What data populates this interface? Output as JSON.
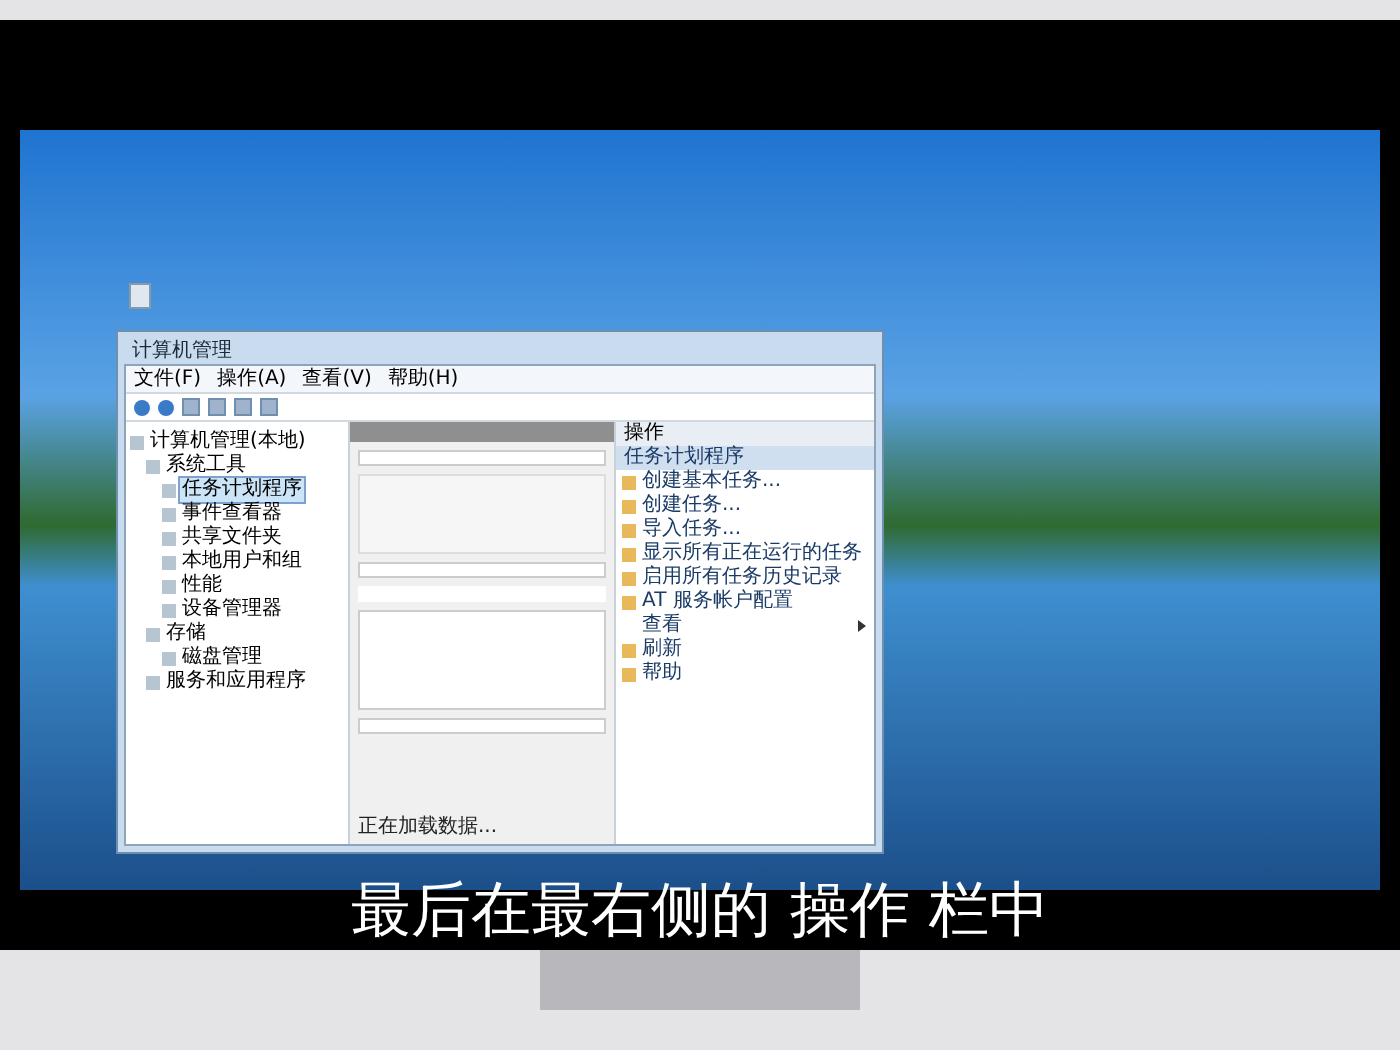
{
  "subtitle": "最后在最右侧的 操作 栏中",
  "window": {
    "title": "计算机管理",
    "menu": [
      "文件(F)",
      "操作(A)",
      "查看(V)",
      "帮助(H)"
    ],
    "tree": [
      {
        "label": "计算机管理(本地)",
        "selected": false,
        "children": [
          {
            "label": "系统工具",
            "selected": false,
            "children": [
              {
                "label": "任务计划程序",
                "selected": true
              },
              {
                "label": "事件查看器",
                "selected": false
              },
              {
                "label": "共享文件夹",
                "selected": false
              },
              {
                "label": "本地用户和组",
                "selected": false
              },
              {
                "label": "性能",
                "selected": false
              },
              {
                "label": "设备管理器",
                "selected": false
              }
            ]
          },
          {
            "label": "存储",
            "selected": false,
            "children": [
              {
                "label": "磁盘管理",
                "selected": false
              }
            ]
          },
          {
            "label": "服务和应用程序",
            "selected": false
          }
        ]
      }
    ],
    "status": "正在加载数据...",
    "actions": {
      "header": "操作",
      "section": "任务计划程序",
      "items": [
        {
          "kind": "item",
          "label": "创建基本任务..."
        },
        {
          "kind": "item",
          "label": "创建任务..."
        },
        {
          "kind": "item",
          "label": "导入任务..."
        },
        {
          "kind": "item",
          "label": "显示所有正在运行的任务"
        },
        {
          "kind": "item",
          "label": "启用所有任务历史记录"
        },
        {
          "kind": "item",
          "label": "AT 服务帐户配置"
        },
        {
          "kind": "submenu",
          "label": "查看"
        },
        {
          "kind": "item",
          "label": "刷新"
        },
        {
          "kind": "item",
          "label": "帮助"
        }
      ]
    }
  }
}
